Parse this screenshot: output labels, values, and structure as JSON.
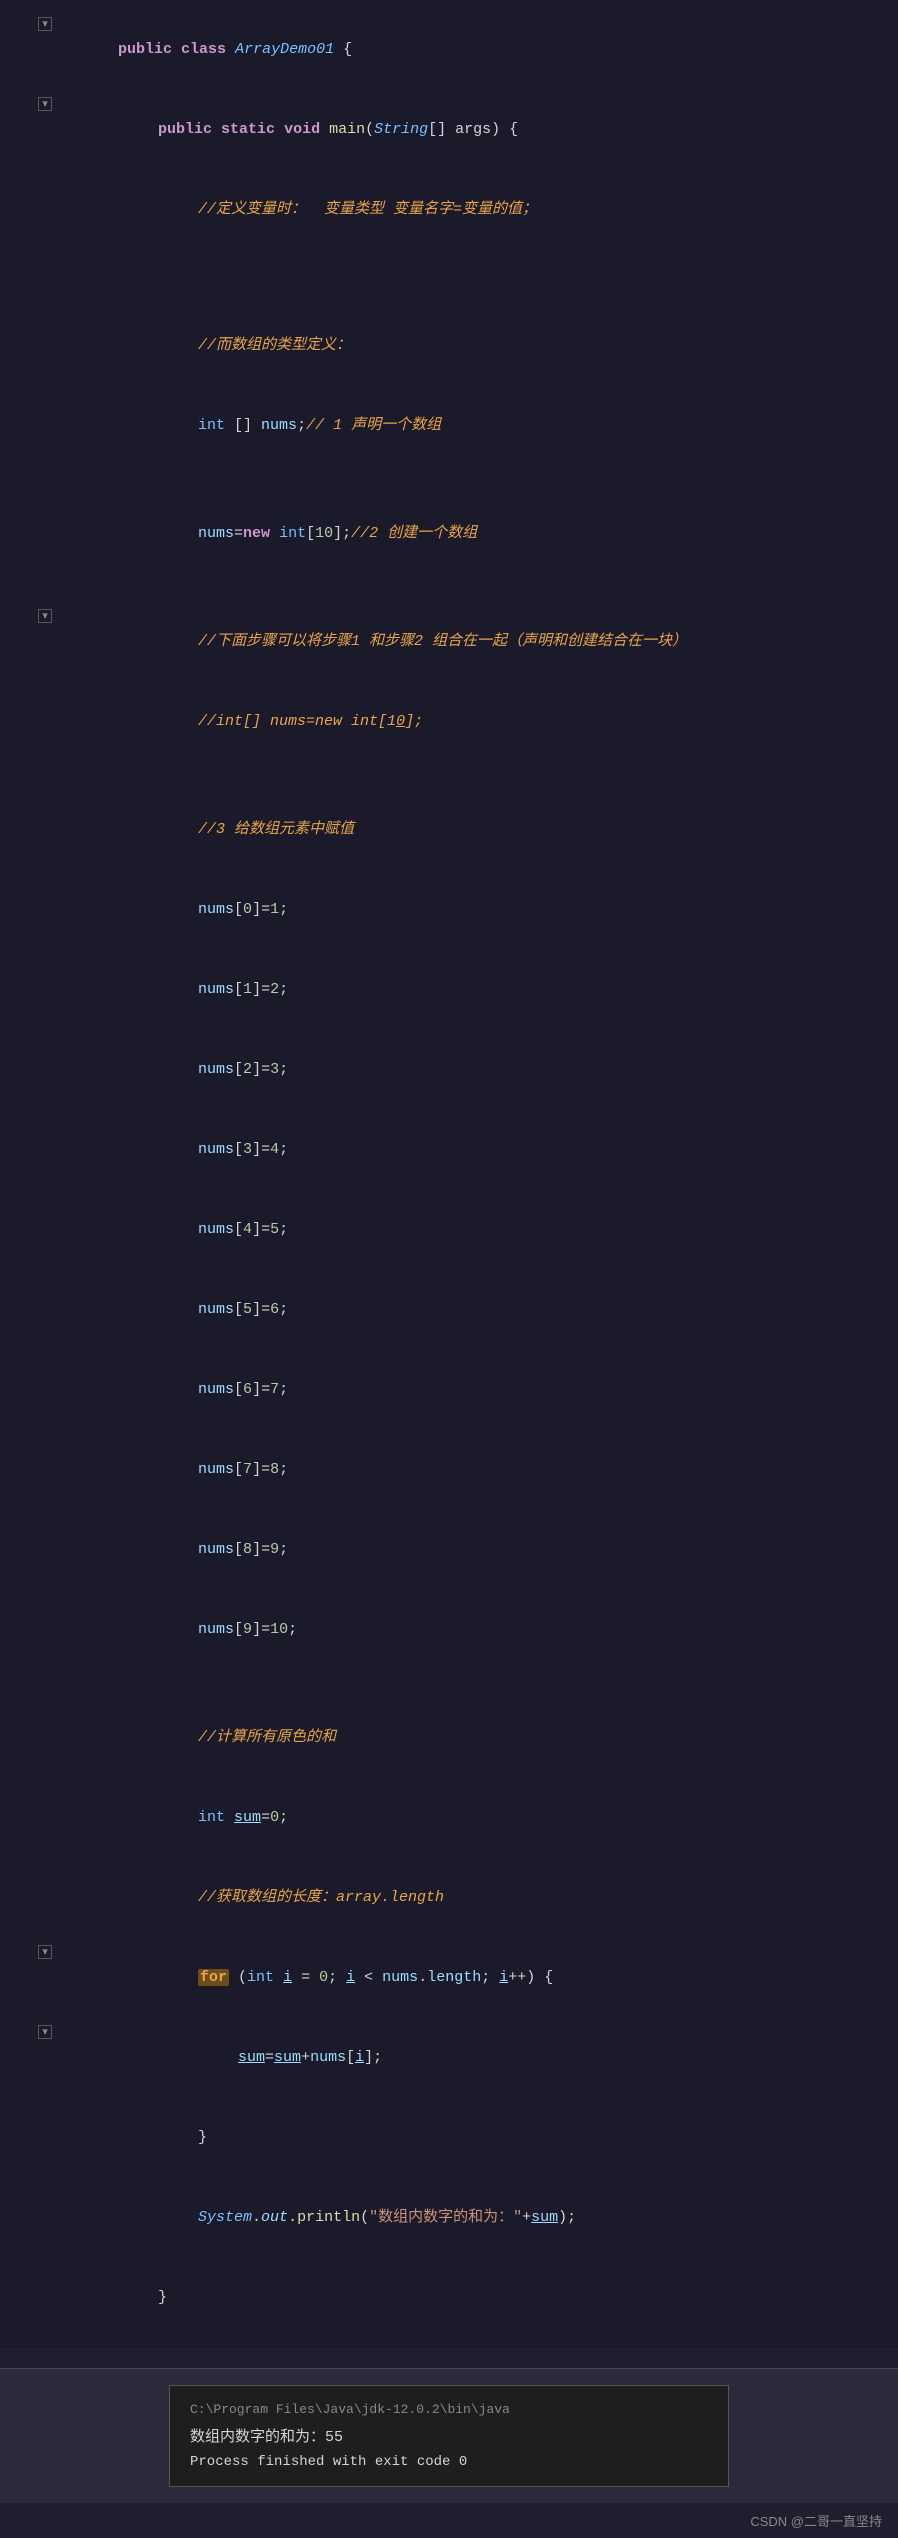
{
  "editor": {
    "lines": [
      {
        "num": "",
        "indent": 0,
        "tokens": [
          {
            "t": "kw",
            "v": "public"
          },
          {
            "t": "plain",
            "v": " "
          },
          {
            "t": "kw",
            "v": "class"
          },
          {
            "t": "plain",
            "v": " "
          },
          {
            "t": "classname",
            "v": "ArrayDemo01"
          },
          {
            "t": "plain",
            "v": " {"
          }
        ],
        "fold": false
      },
      {
        "num": "",
        "indent": 1,
        "tokens": [
          {
            "t": "kw",
            "v": "public"
          },
          {
            "t": "plain",
            "v": " "
          },
          {
            "t": "kw",
            "v": "static"
          },
          {
            "t": "plain",
            "v": " "
          },
          {
            "t": "kw",
            "v": "void"
          },
          {
            "t": "plain",
            "v": " "
          },
          {
            "t": "method",
            "v": "main"
          },
          {
            "t": "plain",
            "v": "("
          },
          {
            "t": "classname",
            "v": "String"
          },
          {
            "t": "plain",
            "v": "[] args) {"
          }
        ],
        "fold": false
      },
      {
        "num": "",
        "indent": 2,
        "tokens": [
          {
            "t": "comment-cn",
            "v": "//定义变量时：  变量类型 变量名字=变量的值；"
          }
        ],
        "fold": false
      },
      {
        "num": "empty",
        "indent": 0,
        "tokens": [],
        "fold": false
      },
      {
        "num": "empty",
        "indent": 0,
        "tokens": [],
        "fold": false
      },
      {
        "num": "",
        "indent": 2,
        "tokens": [
          {
            "t": "comment-cn",
            "v": "//而数组的类型定义："
          }
        ],
        "fold": false
      },
      {
        "num": "",
        "indent": 2,
        "tokens": [
          {
            "t": "type",
            "v": "int"
          },
          {
            "t": "plain",
            "v": " [] "
          },
          {
            "t": "ident",
            "v": "nums"
          },
          {
            "t": "plain",
            "v": ";"
          },
          {
            "t": "comment-cn",
            "v": "// 1 声明一个数组"
          }
        ],
        "fold": false
      },
      {
        "num": "empty",
        "indent": 0,
        "tokens": [],
        "fold": false
      },
      {
        "num": "",
        "indent": 2,
        "tokens": [
          {
            "t": "ident",
            "v": "nums"
          },
          {
            "t": "plain",
            "v": "="
          },
          {
            "t": "kw",
            "v": "new"
          },
          {
            "t": "plain",
            "v": " "
          },
          {
            "t": "type",
            "v": "int"
          },
          {
            "t": "plain",
            "v": "["
          },
          {
            "t": "number",
            "v": "10"
          },
          {
            "t": "plain",
            "v": "];"
          },
          {
            "t": "comment-cn",
            "v": "//2 创建一个数组"
          }
        ],
        "fold": false
      },
      {
        "num": "empty",
        "indent": 0,
        "tokens": [],
        "fold": false
      },
      {
        "num": "",
        "indent": 2,
        "tokens": [
          {
            "t": "comment-cn",
            "v": "//下面步骤可以将步骤1 和步骤2 组合在一起（声明和创建结合在一块）"
          }
        ],
        "fold": false
      },
      {
        "num": "",
        "indent": 2,
        "tokens": [
          {
            "t": "comment-cn",
            "v": "//int[] nums=new int[10];"
          }
        ],
        "fold": false
      },
      {
        "num": "empty",
        "indent": 0,
        "tokens": [],
        "fold": false
      },
      {
        "num": "",
        "indent": 2,
        "tokens": [
          {
            "t": "comment-cn",
            "v": "//3 给数组元素中赋值"
          }
        ],
        "fold": false
      },
      {
        "num": "",
        "indent": 2,
        "tokens": [
          {
            "t": "ident",
            "v": "nums"
          },
          {
            "t": "plain",
            "v": "["
          },
          {
            "t": "number",
            "v": "0"
          },
          {
            "t": "plain",
            "v": "]="
          },
          {
            "t": "number",
            "v": "1"
          },
          {
            "t": "plain",
            "v": ";"
          }
        ],
        "fold": false
      },
      {
        "num": "",
        "indent": 2,
        "tokens": [
          {
            "t": "ident",
            "v": "nums"
          },
          {
            "t": "plain",
            "v": "["
          },
          {
            "t": "number",
            "v": "1"
          },
          {
            "t": "plain",
            "v": "]="
          },
          {
            "t": "number",
            "v": "2"
          },
          {
            "t": "plain",
            "v": ";"
          }
        ],
        "fold": false
      },
      {
        "num": "",
        "indent": 2,
        "tokens": [
          {
            "t": "ident",
            "v": "nums"
          },
          {
            "t": "plain",
            "v": "["
          },
          {
            "t": "number",
            "v": "2"
          },
          {
            "t": "plain",
            "v": "]="
          },
          {
            "t": "number",
            "v": "3"
          },
          {
            "t": "plain",
            "v": ";"
          }
        ],
        "fold": false
      },
      {
        "num": "",
        "indent": 2,
        "tokens": [
          {
            "t": "ident",
            "v": "nums"
          },
          {
            "t": "plain",
            "v": "["
          },
          {
            "t": "number",
            "v": "3"
          },
          {
            "t": "plain",
            "v": "]="
          },
          {
            "t": "number",
            "v": "4"
          },
          {
            "t": "plain",
            "v": ";"
          }
        ],
        "fold": false
      },
      {
        "num": "",
        "indent": 2,
        "tokens": [
          {
            "t": "ident",
            "v": "nums"
          },
          {
            "t": "plain",
            "v": "["
          },
          {
            "t": "number",
            "v": "4"
          },
          {
            "t": "plain",
            "v": "]="
          },
          {
            "t": "number",
            "v": "5"
          },
          {
            "t": "plain",
            "v": ";"
          }
        ],
        "fold": false
      },
      {
        "num": "",
        "indent": 2,
        "tokens": [
          {
            "t": "ident",
            "v": "nums"
          },
          {
            "t": "plain",
            "v": "["
          },
          {
            "t": "number",
            "v": "5"
          },
          {
            "t": "plain",
            "v": "]="
          },
          {
            "t": "number",
            "v": "6"
          },
          {
            "t": "plain",
            "v": ";"
          }
        ],
        "fold": false
      },
      {
        "num": "",
        "indent": 2,
        "tokens": [
          {
            "t": "ident",
            "v": "nums"
          },
          {
            "t": "plain",
            "v": "["
          },
          {
            "t": "number",
            "v": "6"
          },
          {
            "t": "plain",
            "v": "]="
          },
          {
            "t": "number",
            "v": "7"
          },
          {
            "t": "plain",
            "v": ";"
          }
        ],
        "fold": false
      },
      {
        "num": "",
        "indent": 2,
        "tokens": [
          {
            "t": "ident",
            "v": "nums"
          },
          {
            "t": "plain",
            "v": "["
          },
          {
            "t": "number",
            "v": "7"
          },
          {
            "t": "plain",
            "v": "]="
          },
          {
            "t": "number",
            "v": "8"
          },
          {
            "t": "plain",
            "v": ";"
          }
        ],
        "fold": false
      },
      {
        "num": "",
        "indent": 2,
        "tokens": [
          {
            "t": "ident",
            "v": "nums"
          },
          {
            "t": "plain",
            "v": "["
          },
          {
            "t": "number",
            "v": "8"
          },
          {
            "t": "plain",
            "v": "]="
          },
          {
            "t": "number",
            "v": "9"
          },
          {
            "t": "plain",
            "v": ";"
          }
        ],
        "fold": false
      },
      {
        "num": "",
        "indent": 2,
        "tokens": [
          {
            "t": "ident",
            "v": "nums"
          },
          {
            "t": "plain",
            "v": "["
          },
          {
            "t": "number",
            "v": "9"
          },
          {
            "t": "plain",
            "v": "]="
          },
          {
            "t": "number",
            "v": "10"
          },
          {
            "t": "plain",
            "v": ";"
          }
        ],
        "fold": false
      },
      {
        "num": "empty",
        "indent": 0,
        "tokens": [],
        "fold": false
      },
      {
        "num": "",
        "indent": 2,
        "tokens": [
          {
            "t": "comment-cn",
            "v": "//计算所有原色的和"
          }
        ],
        "fold": false
      },
      {
        "num": "",
        "indent": 2,
        "tokens": [
          {
            "t": "type",
            "v": "int"
          },
          {
            "t": "plain",
            "v": " "
          },
          {
            "t": "ident-underline",
            "v": "sum"
          },
          {
            "t": "plain",
            "v": "="
          },
          {
            "t": "number",
            "v": "0"
          },
          {
            "t": "plain",
            "v": ";"
          }
        ],
        "fold": false
      },
      {
        "num": "",
        "indent": 2,
        "tokens": [
          {
            "t": "comment-cn",
            "v": "//获取数组的长度：array.length"
          }
        ],
        "fold": false
      },
      {
        "num": "",
        "indent": 2,
        "tokens": [
          {
            "t": "for-line",
            "v": "for (int i = 0; i < nums.length; i++) {"
          }
        ],
        "fold": false
      },
      {
        "num": "",
        "indent": 3,
        "tokens": [
          {
            "t": "ident-underline",
            "v": "sum"
          },
          {
            "t": "plain",
            "v": "="
          },
          {
            "t": "ident-underline",
            "v": "sum"
          },
          {
            "t": "plain",
            "v": "+"
          },
          {
            "t": "ident",
            "v": "nums"
          },
          {
            "t": "plain",
            "v": "["
          },
          {
            "t": "ident-underline",
            "v": "i"
          },
          {
            "t": "plain",
            "v": "];"
          }
        ],
        "fold": false
      },
      {
        "num": "",
        "indent": 2,
        "tokens": [
          {
            "t": "plain",
            "v": "}"
          }
        ],
        "fold": false
      },
      {
        "num": "",
        "indent": 2,
        "tokens": [
          {
            "t": "system-line",
            "v": "System.out.println(\"数组内数字的和为：\"+sum);"
          }
        ],
        "fold": false
      },
      {
        "num": "",
        "indent": 1,
        "tokens": [
          {
            "t": "plain",
            "v": "}"
          }
        ],
        "fold": false
      }
    ],
    "fold_lines": [
      1,
      2,
      10,
      28,
      30
    ]
  },
  "output": {
    "path": "C:\\Program Files\\Java\\jdk-12.0.2\\bin\\java",
    "result": "数组内数字的和为：55",
    "process": "Process finished with exit code 0"
  },
  "watermark": "CSDN @二哥一直坚持"
}
